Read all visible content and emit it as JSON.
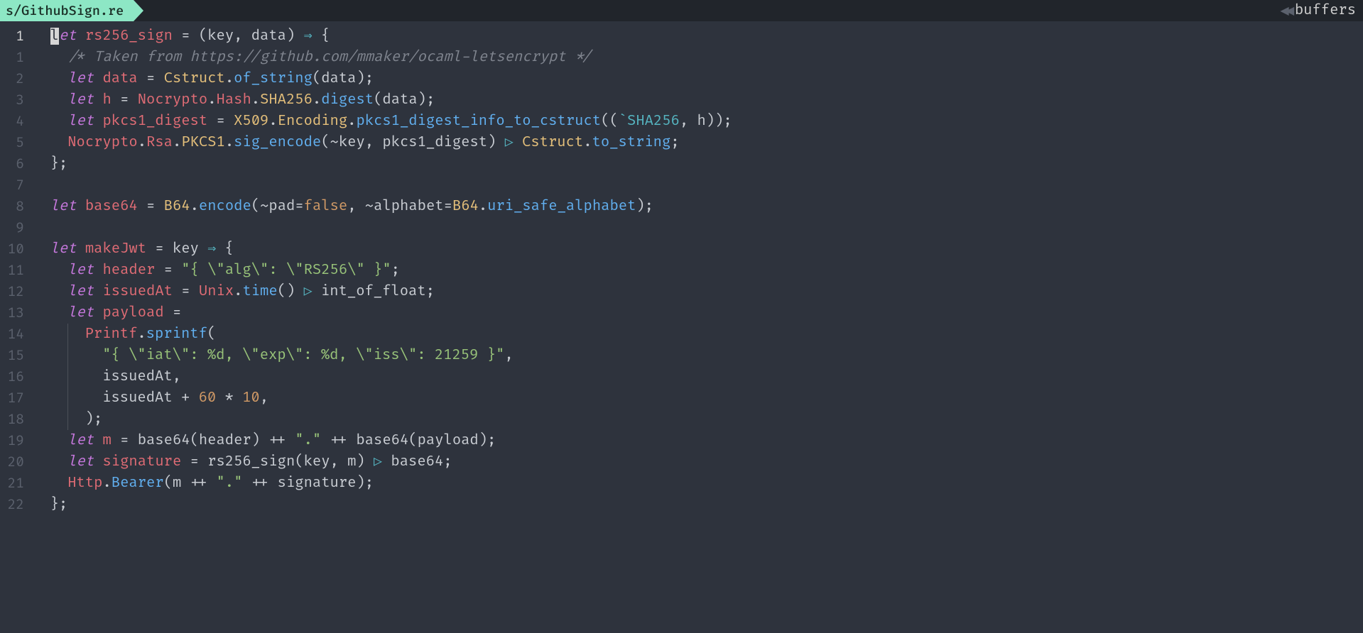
{
  "tab": {
    "label": "s/GithubSign.re"
  },
  "buffers_label": "buffers",
  "gutter": {
    "current": "1",
    "rel": [
      "1",
      "2",
      "3",
      "4",
      "5",
      "6",
      "7",
      "8",
      "9",
      "10",
      "11",
      "12",
      "13",
      "14",
      "15",
      "16",
      "17",
      "18",
      "19",
      "20",
      "21",
      "22"
    ]
  },
  "code": {
    "l1": {
      "let": "let",
      "name": "rs256_sign",
      "rest": " = (key, data) ",
      "arrow": "⇒",
      "brace": " {"
    },
    "l2": {
      "comment": "/* Taken from https://github.com/mmaker/ocaml-letsencrypt */"
    },
    "l3": {
      "let": "let",
      "var": "data",
      "eq": " = ",
      "mod": "Cstruct",
      "fn": "of_string",
      "args": "(data);"
    },
    "l4": {
      "let": "let",
      "var": "h",
      "eq": " = ",
      "mod": "Nocrypto",
      "mod2": "Hash",
      "mod3": "SHA256",
      "fn": "digest",
      "args": "(data);"
    },
    "l5": {
      "let": "let",
      "var": "pkcs1_digest",
      "eq": " = ",
      "mod": "X509",
      "mod2": "Encoding",
      "fn": "pkcs1_digest_info_to_cstruct",
      "poly": "`SHA256",
      "args_rest": ", h));"
    },
    "l6": {
      "mod": "Nocrypto",
      "mod2": "Rsa",
      "mod3": "PKCS1",
      "fn": "sig_encode",
      "args": "(~key, pkcs1_digest) ",
      "pipe": "▷",
      "mod4": " Cstruct",
      "fn2": "to_string",
      "semi": ";"
    },
    "l7": {
      "text": "};"
    },
    "l9": {
      "let": "let",
      "name": "base64",
      "eq": " = ",
      "mod": "B64",
      "fn": "encode",
      "args_a": "(~pad=",
      "false": "false",
      "args_b": ", ~alphabet=",
      "mod2": "B64",
      "field": "uri_safe_alphabet",
      "end": ");"
    },
    "l11": {
      "let": "let",
      "name": "makeJwt",
      "eq": " = key ",
      "arrow": "⇒",
      "brace": " {"
    },
    "l12": {
      "let": "let",
      "var": "header",
      "eq": " = ",
      "str": "\"{ \\\"alg\\\": \\\"RS256\\\" }\"",
      "semi": ";"
    },
    "l13": {
      "let": "let",
      "var": "issuedAt",
      "eq": " = ",
      "mod": "Unix",
      "fn": "time",
      "args": "() ",
      "pipe": "▷",
      "rest": " int_of_float;"
    },
    "l14": {
      "let": "let",
      "var": "payload",
      "eq": " ="
    },
    "l15": {
      "mod": "Printf",
      "fn": "sprintf",
      "paren": "("
    },
    "l16": {
      "str": "\"{ \\\"iat\\\": %d, \\\"exp\\\": %d, \\\"iss\\\": 21259 }\"",
      "comma": ","
    },
    "l17": {
      "text": "issuedAt,"
    },
    "l18": {
      "a": "issuedAt + ",
      "n1": "60",
      "mul": " * ",
      "n2": "10",
      "comma": ","
    },
    "l19": {
      "text": ");"
    },
    "l20": {
      "let": "let",
      "var": "m",
      "eq": " = base64(header) ++ ",
      "str": "\".\"",
      "rest": " ++ base64(payload);"
    },
    "l21": {
      "let": "let",
      "var": "signature",
      "eq": " = rs256_sign(key, m) ",
      "pipe": "▷",
      "rest": " base64;"
    },
    "l22": {
      "mod": "Http",
      "fn": "Bearer",
      "a": "(m ++ ",
      "str": "\".\"",
      "b": " ++ signature);"
    },
    "l23": {
      "text": "};"
    }
  }
}
